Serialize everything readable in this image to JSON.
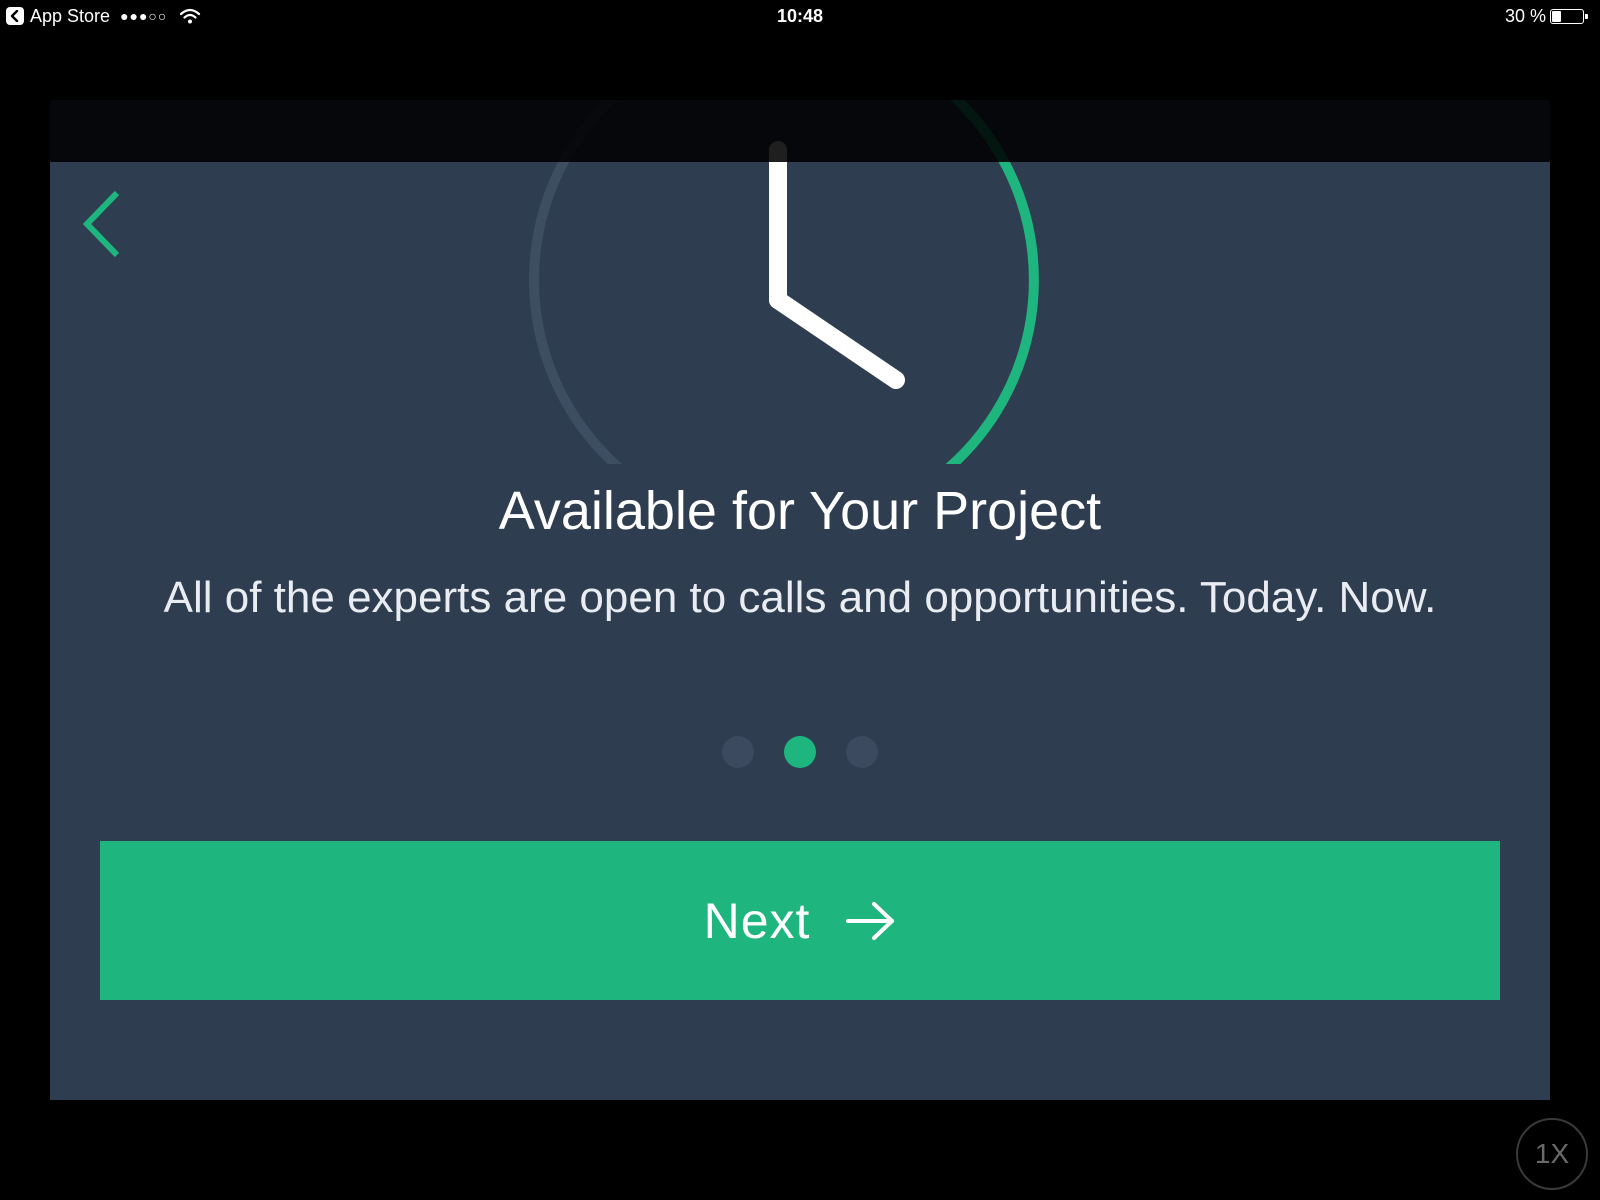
{
  "status_bar": {
    "back_app_label": "App Store",
    "signal_dots": "●●●○○",
    "time": "10:48",
    "battery_percent_label": "30 %",
    "battery_level": 0.3
  },
  "onboarding": {
    "back_icon": "chevron-left-icon",
    "illustration_icon": "clock-icon",
    "title": "Available for Your Project",
    "description": "All of the experts are open to calls and opportunities. Today. Now.",
    "pages_total": 3,
    "active_page": 2,
    "next_label": "Next",
    "next_icon": "arrow-right-icon"
  },
  "zoom_badge": {
    "label": "1X"
  },
  "colors": {
    "accent": "#1fb57f",
    "panel": "#2e3d50",
    "inactive_dot": "#3b4a5e",
    "background": "#000000"
  }
}
